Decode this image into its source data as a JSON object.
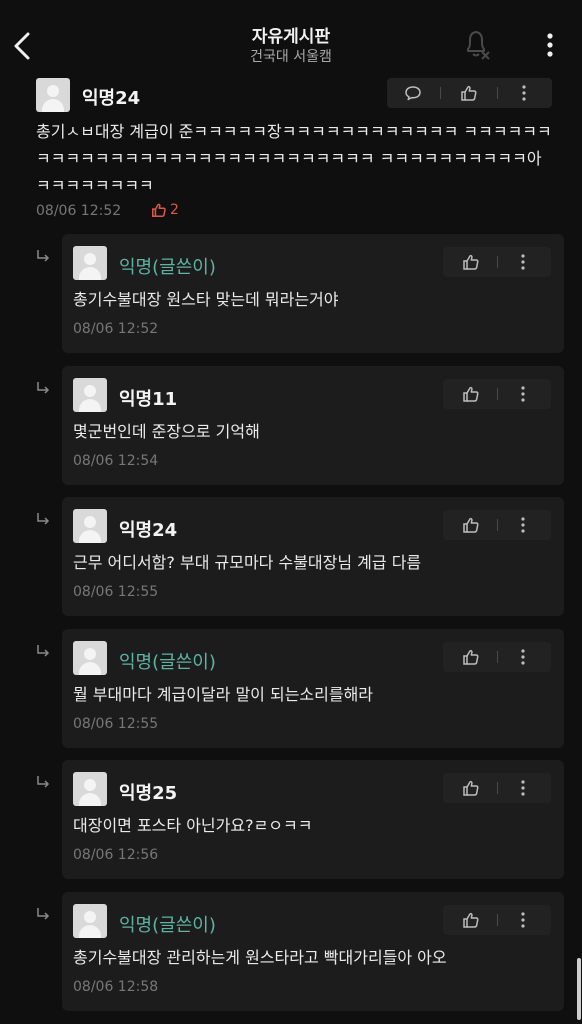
{
  "header": {
    "title": "자유게시판",
    "subtitle": "건국대 서울캠"
  },
  "main_comment": {
    "author": "익명24",
    "text": "총기ㅅㅂ대장 계급이 준ㅋㅋㅋㅋㅋ장ㅋㅋㅋㅋㅋㅋㅋㅋㅋㅋㅋㅋ ㅋㅋㅋㅋㅋㅋㅋㅋㅋㅋㅋㅋㅋㅋㅋㅋㅋㅋㅋㅋㅋㅋㅋㅋㅋㅋㅋㅋㅋ ㅋㅋㅋㅋㅋㅋㅋㅋㅋㅋ아 ㅋㅋㅋㅋㅋㅋㅋㅋ",
    "time": "08/06 12:52",
    "likes": "2",
    "like_color": "#e0574a"
  },
  "replies": [
    {
      "author": "익명(글쓴이)",
      "is_op": true,
      "text": "총기수불대장 원스타 맞는데 뭐라는거야",
      "time": "08/06 12:52"
    },
    {
      "author": "익명11",
      "is_op": false,
      "text": "몇군번인데 준장으로 기억해",
      "time": "08/06 12:54"
    },
    {
      "author": "익명24",
      "is_op": false,
      "text": "근무 어디서함? 부대 규모마다 수불대장님 계급 다름",
      "time": "08/06 12:55"
    },
    {
      "author": "익명(글쓴이)",
      "is_op": true,
      "text": "뭘 부대마다 계급이달라 말이 되는소리를해라",
      "time": "08/06 12:55"
    },
    {
      "author": "익명25",
      "is_op": false,
      "text": "대장이면 포스타 아닌가요?ㄹㅇㅋㅋ",
      "time": "08/06 12:56"
    },
    {
      "author": "익명(글쓴이)",
      "is_op": true,
      "text": "총기수불대장 관리하는게 원스타라고 빡대가리들아 아오",
      "time": "08/06 12:58"
    }
  ],
  "colors": {
    "background": "#0f0f0f",
    "card": "#1c1c1c",
    "op_author": "#5fb3a2"
  },
  "icons": {
    "back": "chevron-left-icon",
    "bell_off": "bell-off-icon",
    "more": "more-vertical-icon",
    "comment": "comment-icon",
    "like": "thumbs-up-icon"
  }
}
